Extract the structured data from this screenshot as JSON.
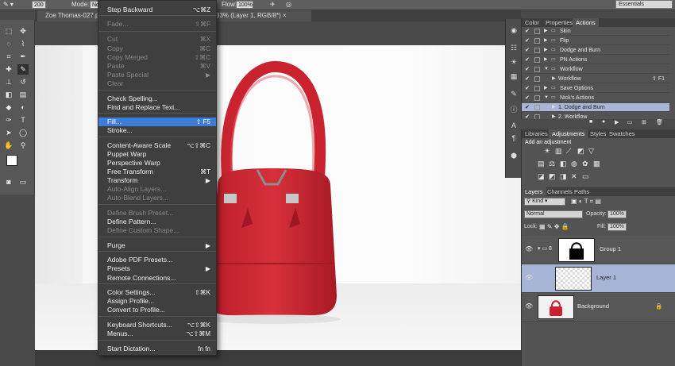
{
  "options_bar": {
    "size_value": "200",
    "mode_label": "Mode:",
    "mode_value": "No",
    "flow_label": "Flow:",
    "flow_value": "100%",
    "workspace": "Essentials"
  },
  "document": {
    "tab_left": "Zoe Thomas-027.p",
    "tab_right": "33% (Layer 1, RGB/8*) ×"
  },
  "menu": {
    "items": [
      {
        "label": "Step Backward",
        "shortcut": "⌥⌘Z",
        "state": "enabled"
      },
      {
        "label": "Fade...",
        "shortcut": "⇧⌘F",
        "state": "disabled"
      },
      {
        "label": "Cut",
        "shortcut": "⌘X",
        "state": "disabled"
      },
      {
        "label": "Copy",
        "shortcut": "⌘C",
        "state": "disabled"
      },
      {
        "label": "Copy Merged",
        "shortcut": "⇧⌘C",
        "state": "disabled"
      },
      {
        "label": "Paste",
        "shortcut": "⌘V",
        "state": "disabled"
      },
      {
        "label": "Paste Special",
        "shortcut": "▶",
        "state": "disabled"
      },
      {
        "label": "Clear",
        "shortcut": "",
        "state": "disabled"
      },
      {
        "label": "Check Spelling...",
        "shortcut": "",
        "state": "enabled"
      },
      {
        "label": "Find and Replace Text...",
        "shortcut": "",
        "state": "enabled"
      },
      {
        "label": "Fill...",
        "shortcut": "⇧ F5",
        "state": "selected"
      },
      {
        "label": "Stroke...",
        "shortcut": "",
        "state": "enabled"
      },
      {
        "label": "Content-Aware Scale",
        "shortcut": "⌥⇧⌘C",
        "state": "enabled"
      },
      {
        "label": "Puppet Warp",
        "shortcut": "",
        "state": "enabled"
      },
      {
        "label": "Perspective Warp",
        "shortcut": "",
        "state": "enabled"
      },
      {
        "label": "Free Transform",
        "shortcut": "⌘T",
        "state": "enabled"
      },
      {
        "label": "Transform",
        "shortcut": "▶",
        "state": "enabled"
      },
      {
        "label": "Auto-Align Layers...",
        "shortcut": "",
        "state": "disabled"
      },
      {
        "label": "Auto-Blend Layers...",
        "shortcut": "",
        "state": "disabled"
      },
      {
        "label": "Define Brush Preset...",
        "shortcut": "",
        "state": "disabled"
      },
      {
        "label": "Define Pattern...",
        "shortcut": "",
        "state": "enabled"
      },
      {
        "label": "Define Custom Shape...",
        "shortcut": "",
        "state": "disabled"
      },
      {
        "label": "Purge",
        "shortcut": "▶",
        "state": "enabled"
      },
      {
        "label": "Adobe PDF Presets...",
        "shortcut": "",
        "state": "enabled"
      },
      {
        "label": "Presets",
        "shortcut": "▶",
        "state": "enabled"
      },
      {
        "label": "Remote Connections...",
        "shortcut": "",
        "state": "enabled"
      },
      {
        "label": "Color Settings...",
        "shortcut": "⇧⌘K",
        "state": "enabled"
      },
      {
        "label": "Assign Profile...",
        "shortcut": "",
        "state": "enabled"
      },
      {
        "label": "Convert to Profile...",
        "shortcut": "",
        "state": "enabled"
      },
      {
        "label": "Keyboard Shortcuts...",
        "shortcut": "⌥⇧⌘K",
        "state": "enabled"
      },
      {
        "label": "Menus...",
        "shortcut": "⌥⇧⌘M",
        "state": "enabled"
      },
      {
        "label": "Start Dictation...",
        "shortcut": "fn fn",
        "state": "enabled"
      }
    ]
  },
  "actions_panel": {
    "tabs": [
      "Color",
      "Properties",
      "Actions"
    ],
    "rows": [
      {
        "label": "Skin",
        "type": "set",
        "expanded": false
      },
      {
        "label": "Flip",
        "type": "set",
        "expanded": false
      },
      {
        "label": "Dodge and Burn",
        "type": "set",
        "expanded": false
      },
      {
        "label": "PN Actions",
        "type": "set",
        "expanded": false
      },
      {
        "label": "Workflow",
        "type": "set",
        "expanded": true
      },
      {
        "label": "Workflow",
        "type": "action",
        "key": "⇧ F1"
      },
      {
        "label": "Save Options",
        "type": "set",
        "expanded": false
      },
      {
        "label": "Nick's Actions",
        "type": "set",
        "expanded": true
      },
      {
        "label": "1. Dodge and Burn",
        "type": "action",
        "highlight": true
      },
      {
        "label": "2. Workflow",
        "type": "action"
      }
    ]
  },
  "adjustments_panel": {
    "tabs": [
      "Libraries",
      "Adjustments",
      "Styles",
      "Swatches"
    ],
    "heading": "Add an adjustment"
  },
  "layers_panel": {
    "tabs": [
      "Layers",
      "Channels",
      "Paths"
    ],
    "kind_label": "Kind",
    "blend_mode": "Normal",
    "opacity_label": "Opacity:",
    "opacity_value": "100%",
    "lock_label": "Lock:",
    "fill_label": "Fill:",
    "fill_value": "100%",
    "layers": [
      {
        "name": "Group 1",
        "selected": false
      },
      {
        "name": "Layer 1",
        "selected": true
      },
      {
        "name": "Background",
        "selected": false
      }
    ]
  },
  "colors": {
    "menu_highlight": "#3d7dd8",
    "layer_selected": "#a6b4d6",
    "bag_red": "#d22a35"
  }
}
